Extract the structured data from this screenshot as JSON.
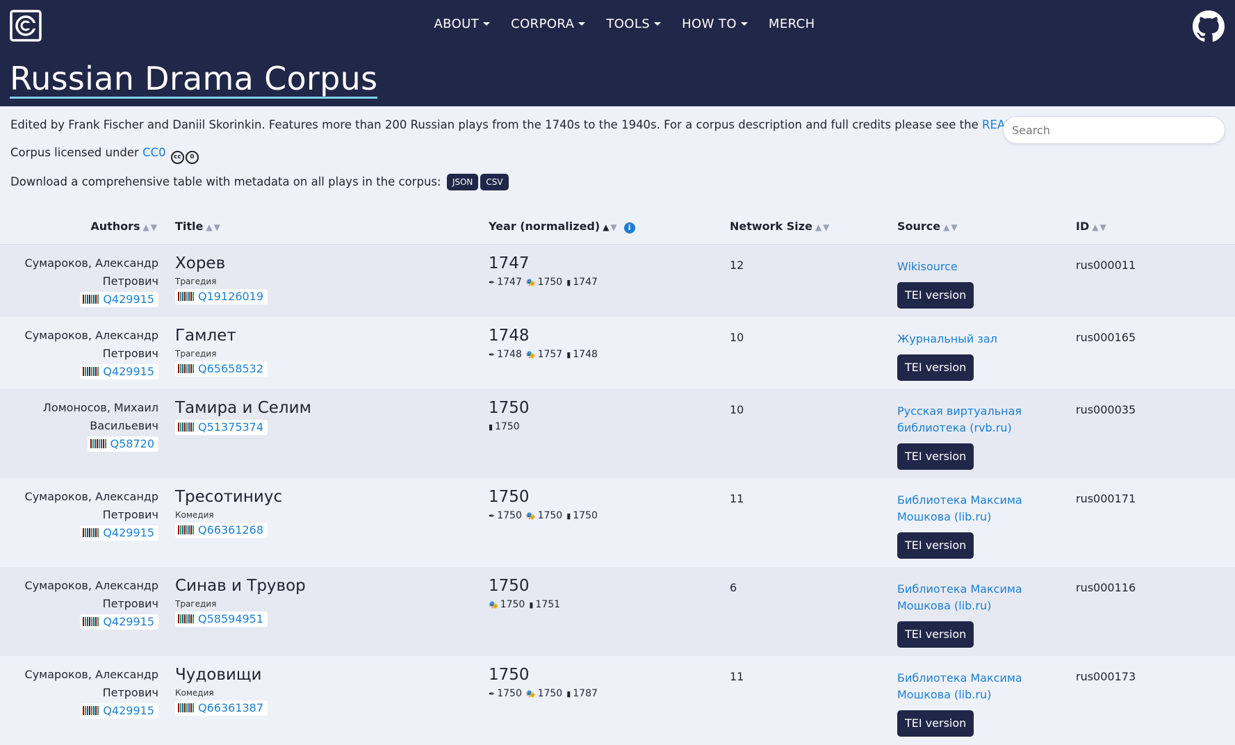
{
  "nav": {
    "items": [
      {
        "label": "ABOUT",
        "dropdown": true
      },
      {
        "label": "CORPORA",
        "dropdown": true
      },
      {
        "label": "TOOLS",
        "dropdown": true
      },
      {
        "label": "HOW TO",
        "dropdown": true
      },
      {
        "label": "MERCH",
        "dropdown": false
      }
    ]
  },
  "corpus": {
    "title": "Russian Drama Corpus",
    "description": "Edited by Frank Fischer and Daniil Skorinkin. Features more than 200 Russian plays from the 1740s to the 1940s. For a corpus description and full credits please see the ",
    "readme_link": "README on GitHub",
    "description_end": ".",
    "license_prefix": "Corpus licensed under ",
    "license_link": "CC0",
    "download_text": "Download a comprehensive table with metadata on all plays in the corpus: ",
    "json_label": "JSON",
    "csv_label": "CSV"
  },
  "search": {
    "placeholder": "Search"
  },
  "table": {
    "headers": {
      "authors": "Authors",
      "title": "Title",
      "year": "Year (normalized)",
      "network": "Network Size",
      "source": "Source",
      "id": "ID"
    },
    "rows": [
      {
        "author_1": "Сумароков, Александр",
        "author_2": "Петрович",
        "author_wd": "Q429915",
        "title": "Хорев",
        "genre": "Трагедия",
        "title_wd": "Q19126019",
        "year": "1747",
        "written": "1747",
        "premiered": "1750",
        "printed": "1747",
        "network": "12",
        "source": "Wikisource",
        "source_2": "",
        "tei": "TEI version",
        "id": "rus000011"
      },
      {
        "author_1": "Сумароков, Александр",
        "author_2": "Петрович",
        "author_wd": "Q429915",
        "title": "Гамлет",
        "genre": "Трагедия",
        "title_wd": "Q65658532",
        "year": "1748",
        "written": "1748",
        "premiered": "1757",
        "printed": "1748",
        "network": "10",
        "source": "Журнальный зал",
        "source_2": "",
        "tei": "TEI version",
        "id": "rus000165"
      },
      {
        "author_1": "Ломоносов, Михаил",
        "author_2": "Васильевич",
        "author_wd": "Q58720",
        "title": "Тамира и Селим",
        "genre": "",
        "title_wd": "Q51375374",
        "year": "1750",
        "written": "",
        "premiered": "",
        "printed": "1750",
        "network": "10",
        "source": "Русская виртуальная",
        "source_2": "библиотека (rvb.ru)",
        "tei": "TEI version",
        "id": "rus000035"
      },
      {
        "author_1": "Сумароков, Александр",
        "author_2": "Петрович",
        "author_wd": "Q429915",
        "title": "Тресотиниус",
        "genre": "Комедия",
        "title_wd": "Q66361268",
        "year": "1750",
        "written": "1750",
        "premiered": "1750",
        "printed": "1750",
        "network": "11",
        "source": "Библиотека Максима",
        "source_2": "Мошкова (lib.ru)",
        "tei": "TEI version",
        "id": "rus000171"
      },
      {
        "author_1": "Сумароков, Александр",
        "author_2": "Петрович",
        "author_wd": "Q429915",
        "title": "Синав и Трувор",
        "genre": "Трагедия",
        "title_wd": "Q58594951",
        "year": "1750",
        "written": "",
        "premiered": "1750",
        "printed": "1751",
        "network": "6",
        "source": "Библиотека Максима",
        "source_2": "Мошкова (lib.ru)",
        "tei": "TEI version",
        "id": "rus000116"
      },
      {
        "author_1": "Сумароков, Александр",
        "author_2": "Петрович",
        "author_wd": "Q429915",
        "title": "Чудовищи",
        "genre": "Комедия",
        "title_wd": "Q66361387",
        "year": "1750",
        "written": "1750",
        "premiered": "1750",
        "printed": "1787",
        "network": "11",
        "source": "Библиотека Максима",
        "source_2": "Мошкова (lib.ru)",
        "tei": "TEI version",
        "id": "rus000173"
      }
    ]
  }
}
